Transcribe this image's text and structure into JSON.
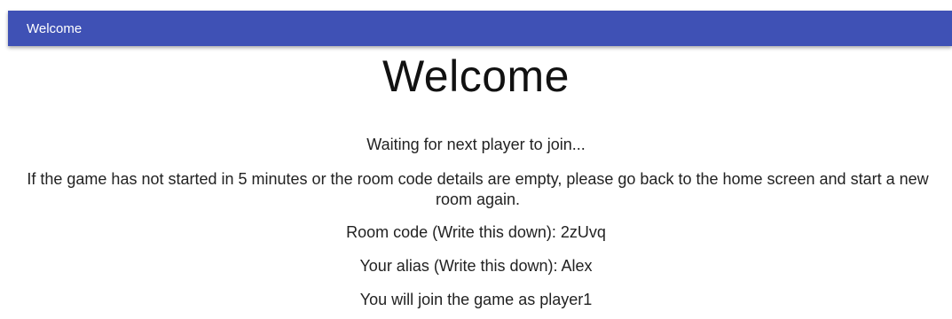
{
  "header": {
    "title": "Welcome",
    "background_color": "#3f51b5"
  },
  "main": {
    "heading": "Welcome",
    "waiting_message": "Waiting for next player to join...",
    "instruction": "If the game has not started in 5 minutes or the room code details are empty, please go back to the home screen and start a new room again.",
    "room_code_line": "Room code (Write this down): 2zUvq",
    "alias_line": "Your alias (Write this down): Alex",
    "player_line": "You will join the game as player1"
  }
}
